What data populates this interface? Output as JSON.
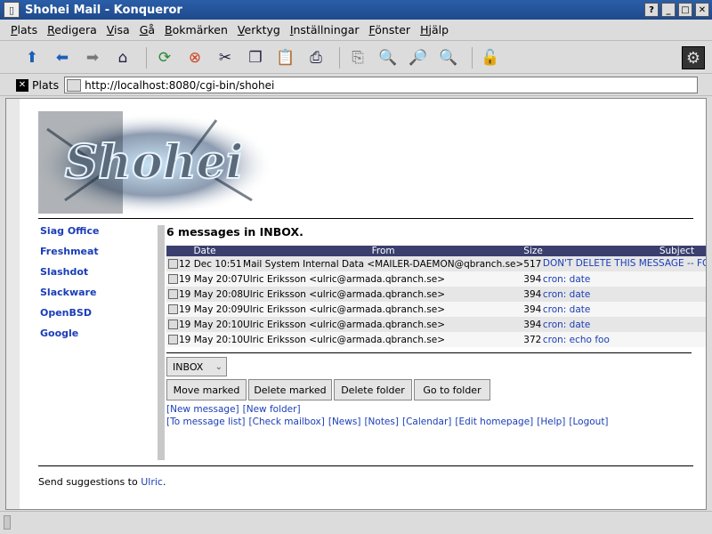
{
  "window": {
    "title": "Shohei Mail - Konqueror",
    "controls": [
      "?",
      "_",
      "□",
      "✕"
    ]
  },
  "menu": [
    "Plats",
    "Redigera",
    "Visa",
    "Gå",
    "Bokmärken",
    "Verktyg",
    "Inställningar",
    "Fönster",
    "Hjälp"
  ],
  "toolbar": {
    "icons": [
      "up-arrow-icon",
      "back-arrow-icon",
      "forward-arrow-icon",
      "home-icon",
      "reload-icon",
      "stop-icon",
      "cut-icon",
      "copy-icon",
      "paste-icon",
      "print-icon",
      "print-preview-icon",
      "zoom-in-icon",
      "zoom-out-icon",
      "zoom-icon",
      "lock-icon"
    ]
  },
  "location": {
    "label": "Plats",
    "url": "http://localhost:8080/cgi-bin/shohei"
  },
  "page": {
    "logo_text": "Shohei",
    "sidebar_links": [
      "Siag Office",
      "Freshmeat",
      "Slashdot",
      "Slackware",
      "OpenBSD",
      "Google"
    ],
    "heading": "6 messages in INBOX.",
    "columns": [
      "Date",
      "From",
      "Size",
      "Subject"
    ],
    "messages": [
      {
        "date": "12 Dec 10:51",
        "from": "Mail System Internal Data <MAILER-DAEMON@qbranch.se>",
        "size": "517",
        "subject": "DON'T DELETE THIS MESSAGE -- FOLDER INTERNAL DATA"
      },
      {
        "date": "19 May 20:07",
        "from": "Ulric Eriksson <ulric@armada.qbranch.se>",
        "size": "394",
        "subject": "cron: date"
      },
      {
        "date": "19 May 20:08",
        "from": "Ulric Eriksson <ulric@armada.qbranch.se>",
        "size": "394",
        "subject": "cron: date"
      },
      {
        "date": "19 May 20:09",
        "from": "Ulric Eriksson <ulric@armada.qbranch.se>",
        "size": "394",
        "subject": "cron: date"
      },
      {
        "date": "19 May 20:10",
        "from": "Ulric Eriksson <ulric@armada.qbranch.se>",
        "size": "394",
        "subject": "cron: date"
      },
      {
        "date": "19 May 20:10",
        "from": "Ulric Eriksson <ulric@armada.qbranch.se>",
        "size": "372",
        "subject": "cron: echo foo"
      }
    ],
    "folder_select": "INBOX",
    "buttons": {
      "move": "Move marked",
      "delete": "Delete marked",
      "delete_folder": "Delete folder",
      "go_folder": "Go to folder"
    },
    "links_row1": [
      "[New message]",
      "[New folder]"
    ],
    "links_row2": [
      "[To message list]",
      "[Check mailbox]",
      "[News]",
      "[Notes]",
      "[Calendar]",
      "[Edit homepage]",
      "[Help]",
      "[Logout]"
    ],
    "footer_prefix": "Send suggestions to ",
    "footer_link": "Ulric",
    "footer_suffix": "."
  }
}
